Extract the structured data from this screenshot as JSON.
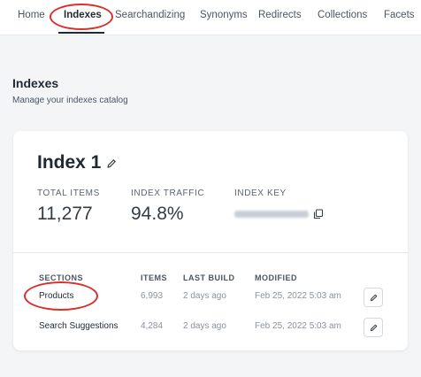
{
  "nav": {
    "tabs": [
      {
        "label": "Home"
      },
      {
        "label": "Indexes"
      },
      {
        "label": "Searchandizing"
      },
      {
        "label": "Synonyms"
      },
      {
        "label": "Redirects"
      },
      {
        "label": "Collections"
      },
      {
        "label": "Facets"
      }
    ],
    "active": "Indexes"
  },
  "page": {
    "title": "Indexes",
    "subtitle": "Manage your indexes catalog"
  },
  "index_card": {
    "title": "Index 1",
    "stats": {
      "total_items_label": "TOTAL ITEMS",
      "total_items_value": "11,277",
      "index_traffic_label": "INDEX TRAFFIC",
      "index_traffic_value": "94.8%",
      "index_key_label": "INDEX KEY"
    },
    "table": {
      "headers": {
        "sections": "SECTIONS",
        "items": "ITEMS",
        "last_build": "LAST BUILD",
        "modified": "MODIFIED"
      },
      "rows": [
        {
          "section": "Products",
          "items": "6,993",
          "last_build": "2 days ago",
          "modified": "Feb 25, 2022 5:03 am"
        },
        {
          "section": "Search Suggestions",
          "items": "4,284",
          "last_build": "2 days ago",
          "modified": "Feb 25, 2022 5:03 am"
        }
      ]
    }
  },
  "icons": {
    "edit": "pencil-icon",
    "copy": "copy-icon"
  },
  "colors": {
    "annotation": "#d9302b",
    "page_background": "#f4f5f7",
    "card_background": "#ffffff"
  }
}
